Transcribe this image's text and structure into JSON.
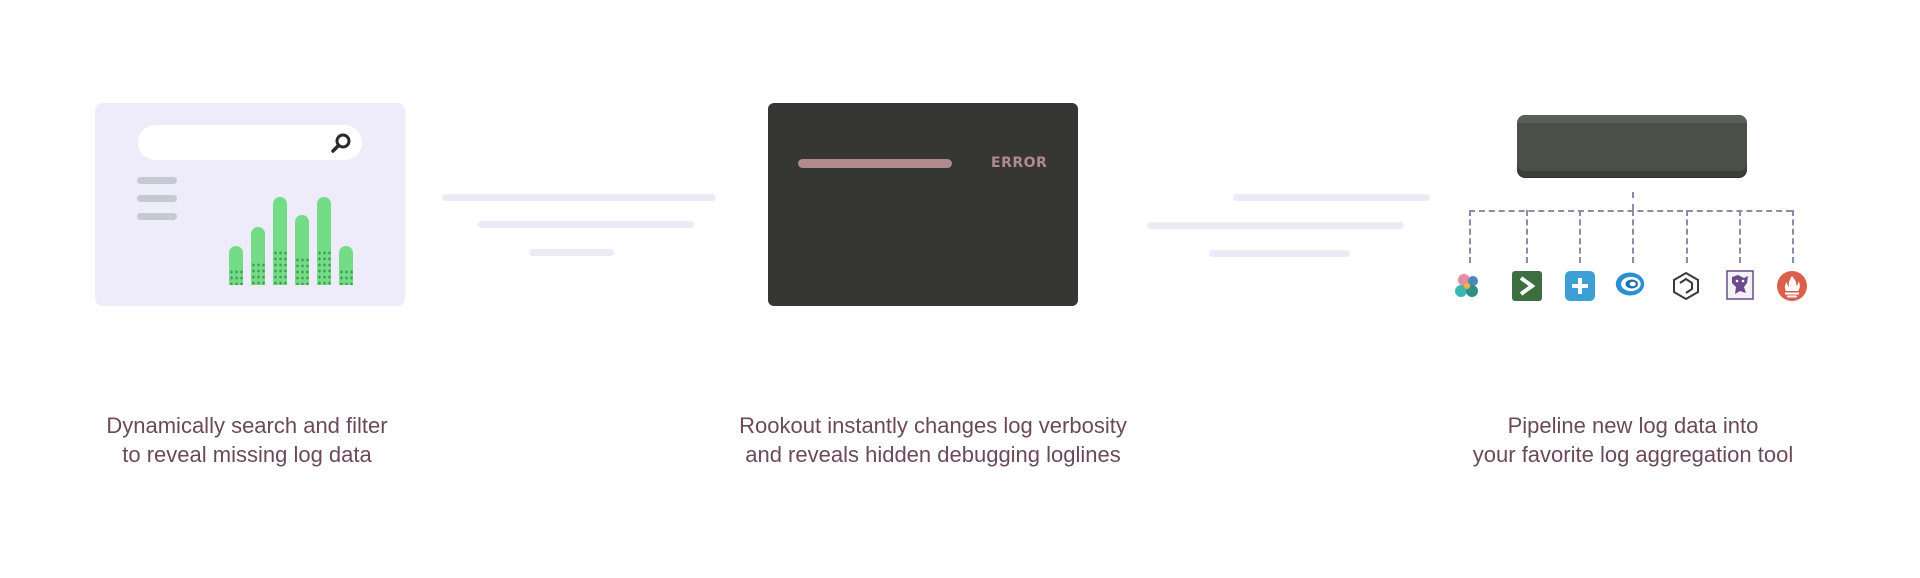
{
  "steps": [
    {
      "caption_line1": "Dynamically search and filter",
      "caption_line2": "to reveal missing log data"
    },
    {
      "caption_line1": "Rookout instantly changes log verbosity",
      "caption_line2": "and reveals hidden debugging loglines",
      "log_level": "ERROR"
    },
    {
      "caption_line1": "Pipeline new log data into",
      "caption_line2": "your favorite log aggregation tool"
    }
  ],
  "chart_levels": [
    0.44,
    0.66,
    1.0,
    0.79,
    1.0,
    0.44
  ],
  "colors": {
    "panel_light": "#eeebfa",
    "panel_dark": "#363634",
    "bar_green": "#74dc86",
    "error_text": "#b08a8c",
    "caption_text": "#6b4a58"
  },
  "tool_icons": [
    "elastic-icon",
    "terminal-icon",
    "plus-icon",
    "swirl-icon",
    "cube-icon",
    "datadog-icon",
    "prometheus-icon"
  ]
}
